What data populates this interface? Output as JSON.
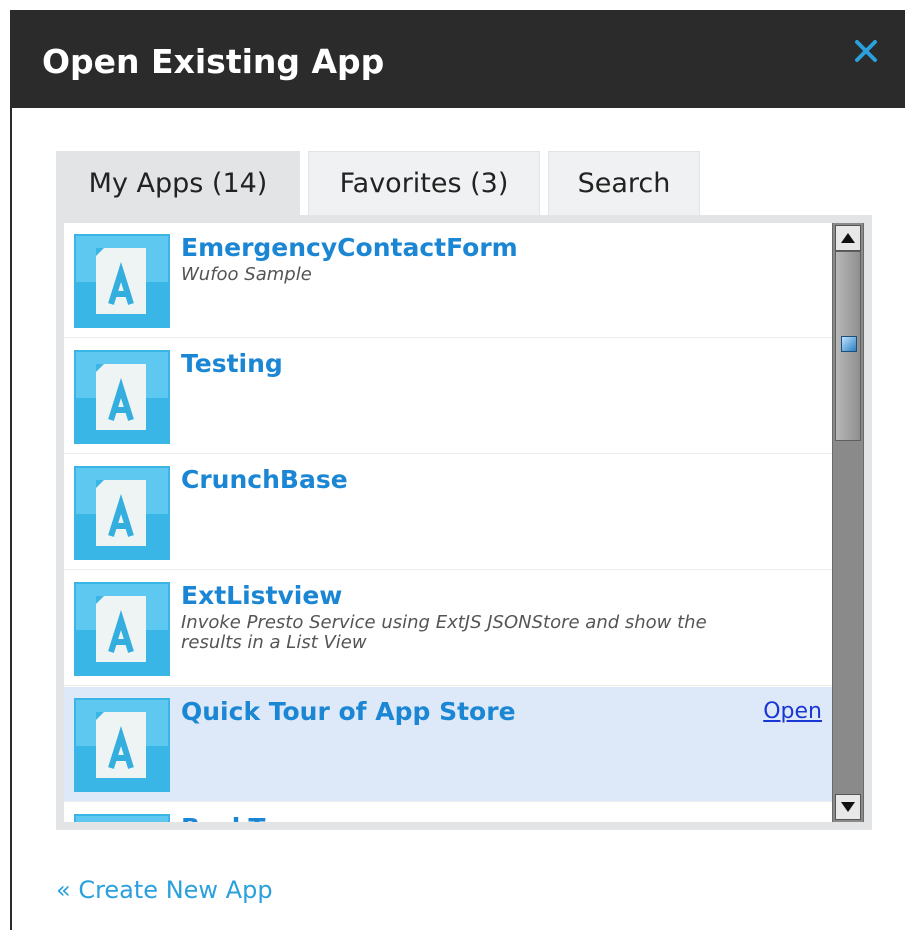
{
  "dialog": {
    "title": "Open Existing App",
    "close_label": "×"
  },
  "tabs": [
    {
      "label": "My Apps (14)",
      "active": true
    },
    {
      "label": "Favorites (3)",
      "active": false
    },
    {
      "label": "Search",
      "active": false
    }
  ],
  "apps": [
    {
      "name": "EmergencyContactForm",
      "description": "Wufoo Sample",
      "icon": "app-document-icon"
    },
    {
      "name": "Testing",
      "description": "",
      "icon": "app-document-icon"
    },
    {
      "name": "CrunchBase",
      "description": "",
      "icon": "app-document-icon"
    },
    {
      "name": "ExtListview",
      "description": "Invoke Presto Service using ExtJS JSONStore and show the results in a List View",
      "icon": "app-document-icon"
    },
    {
      "name": "Quick Tour of App Store",
      "description": "",
      "icon": "app-document-icon",
      "selected": true,
      "action_label": "Open"
    },
    {
      "name": "BackType",
      "description": "",
      "icon": "app-document-icon"
    }
  ],
  "footer": {
    "create_link": "« Create New App"
  },
  "colors": {
    "titlebar": "#2b2b2b",
    "accent": "#1a86d4",
    "close": "#2aa0dd",
    "selected_row": "#dde9f9"
  }
}
